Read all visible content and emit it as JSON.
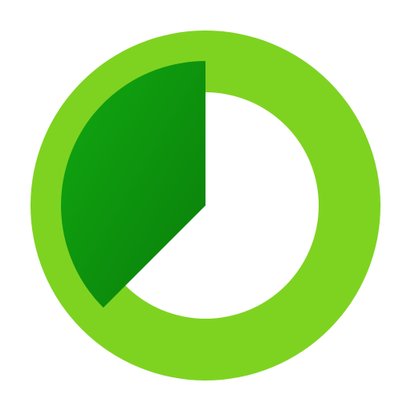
{
  "icon": {
    "name": "timer-progress-icon",
    "progress_fraction": 0.375,
    "colors": {
      "background": "#ffffff",
      "ring": "#7ED321",
      "sector_light": "#11A811",
      "sector_dark": "#0A7E0A",
      "inner": "#ffffff"
    }
  }
}
